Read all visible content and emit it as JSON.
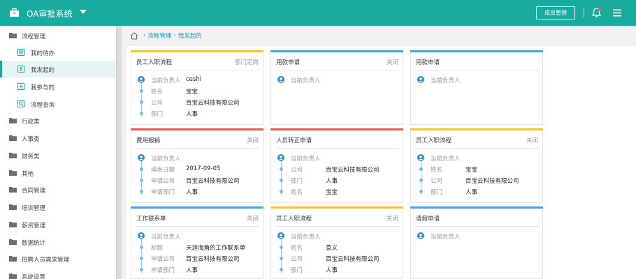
{
  "header": {
    "app_title": "OA审批系统",
    "member_button": "成员管理",
    "colors": {
      "primary": "#1aab9f"
    }
  },
  "sidebar": {
    "items": [
      {
        "label": "流程管理",
        "type": "group",
        "icon": "folder-icon"
      },
      {
        "label": "我的待办",
        "type": "sub",
        "icon": "list-icon"
      },
      {
        "label": "我发起的",
        "type": "sub",
        "icon": "user-card-icon",
        "active": true
      },
      {
        "label": "我参与的",
        "type": "sub",
        "icon": "plus-square-icon"
      },
      {
        "label": "流程查询",
        "type": "sub",
        "icon": "search-doc-icon"
      },
      {
        "label": "行政类",
        "type": "group",
        "icon": "folder-icon"
      },
      {
        "label": "人事类",
        "type": "group",
        "icon": "folder-icon"
      },
      {
        "label": "财务类",
        "type": "group",
        "icon": "folder-icon"
      },
      {
        "label": "其他",
        "type": "group",
        "icon": "folder-icon"
      },
      {
        "label": "合同管理",
        "type": "group",
        "icon": "folder-icon"
      },
      {
        "label": "培训管理",
        "type": "group",
        "icon": "folder-icon"
      },
      {
        "label": "薪资管理",
        "type": "group",
        "icon": "folder-icon"
      },
      {
        "label": "数据统计",
        "type": "group",
        "icon": "folder-icon"
      },
      {
        "label": "招聘人员需求管理",
        "type": "group",
        "icon": "folder-icon"
      },
      {
        "label": "系统设置",
        "type": "group",
        "icon": "folder-icon"
      }
    ]
  },
  "breadcrumb": {
    "level1": "流程管理",
    "level2": "我发起的"
  },
  "cards": [
    {
      "title": "员工入职流程",
      "status": "部门定岗",
      "color": "#f2c249",
      "rows": [
        {
          "k": "当前负责人",
          "v": "ceshi"
        },
        {
          "k": "姓名",
          "v": "宝宝"
        },
        {
          "k": "公司",
          "v": "百宝云科技有限公司"
        },
        {
          "k": "部门",
          "v": "人事"
        }
      ]
    },
    {
      "title": "用款申请",
      "status": "关闭",
      "color": "#4ea3dc",
      "rows": [
        {
          "k": "当前负责人",
          "v": ""
        }
      ]
    },
    {
      "title": "用款申请",
      "status": "",
      "color": "#4ea3dc",
      "rows": [
        {
          "k": "当前负责人",
          "v": ""
        }
      ]
    },
    {
      "title": "费用报销",
      "status": "关闭",
      "color": "#e8625a",
      "rows": [
        {
          "k": "当前负责人",
          "v": ""
        },
        {
          "k": "填表日期",
          "v": "2017-09-05"
        },
        {
          "k": "申请公司",
          "v": "百宝云科技有限公司"
        },
        {
          "k": "申请部门",
          "v": "人事"
        }
      ]
    },
    {
      "title": "人员转正申请",
      "status": "",
      "color": "#e8625a",
      "rows": [
        {
          "k": "当前负责人",
          "v": ""
        },
        {
          "k": "公司",
          "v": "百宝云科技有限公司"
        },
        {
          "k": "部门",
          "v": "人事"
        },
        {
          "k": "姓名",
          "v": "宝宝"
        }
      ]
    },
    {
      "title": "员工入职流程",
      "status": "关闭",
      "color": "#f2c249",
      "rows": [
        {
          "k": "当前负责人",
          "v": ""
        },
        {
          "k": "姓名",
          "v": "宝宝"
        },
        {
          "k": "公司",
          "v": "百宝云科技有限公司"
        },
        {
          "k": "部门",
          "v": "人事"
        }
      ]
    },
    {
      "title": "工作联系单",
      "status": "关闭",
      "color": "#4ea3dc",
      "rows": [
        {
          "k": "当前负责人",
          "v": ""
        },
        {
          "k": "标题",
          "v": "天涯海角的工作联系单"
        },
        {
          "k": "申请公司",
          "v": "百宝云科技有限公司"
        },
        {
          "k": "申请部门",
          "v": "人事"
        }
      ]
    },
    {
      "title": "员工入职流程",
      "status": "关闭",
      "color": "#f2c249",
      "rows": [
        {
          "k": "当前负责人",
          "v": ""
        },
        {
          "k": "姓名",
          "v": "意义"
        },
        {
          "k": "公司",
          "v": "百宝云科技有限公司"
        },
        {
          "k": "部门",
          "v": "人事"
        }
      ]
    },
    {
      "title": "请假申请",
      "status": "",
      "color": "#4ea3dc",
      "rows": [
        {
          "k": "当前负责人",
          "v": ""
        }
      ]
    }
  ]
}
